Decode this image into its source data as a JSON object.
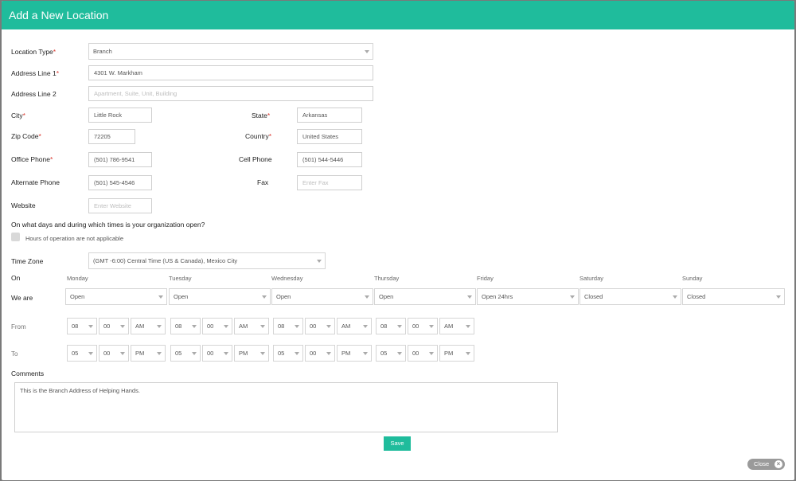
{
  "modal": {
    "title": "Add a New Location",
    "accent_color": "#1fbc9c"
  },
  "form": {
    "location_type": {
      "label": "Location Type",
      "value": "Branch"
    },
    "address1": {
      "label": "Address Line 1",
      "value": "4301 W. Markham"
    },
    "address2": {
      "label": "Address Line 2",
      "placeholder": "Apartment, Suite, Unit, Building"
    },
    "city": {
      "label": "City",
      "value": "Little Rock"
    },
    "state": {
      "label": "State",
      "value": "Arkansas"
    },
    "zip": {
      "label": "Zip Code",
      "value": "72205"
    },
    "country": {
      "label": "Country",
      "value": "United States"
    },
    "office_phone": {
      "label": "Office Phone",
      "value": "(501) 786-9541"
    },
    "cell_phone": {
      "label": "Cell Phone",
      "value": "(501) 544-5446"
    },
    "alt_phone": {
      "label": "Alternate Phone",
      "value": "(501) 545-4546"
    },
    "fax": {
      "label": "Fax",
      "placeholder": "Enter Fax"
    },
    "website": {
      "label": "Website",
      "placeholder": "Enter Website"
    },
    "required_mark": "*"
  },
  "hours": {
    "question": "On what days and during which times is your organization open?",
    "not_applicable": "Hours of operation are not applicable",
    "timezone_label": "Time Zone",
    "timezone_value": "(GMT -6:00) Central Time (US & Canada), Mexico City",
    "on_label": "On",
    "we_are_label": "We are",
    "from_label": "From",
    "to_label": "To",
    "days": [
      {
        "name": "Monday",
        "status": "Open",
        "from": [
          "08",
          "00",
          "AM"
        ],
        "to": [
          "05",
          "00",
          "PM"
        ]
      },
      {
        "name": "Tuesday",
        "status": "Open",
        "from": [
          "08",
          "00",
          "AM"
        ],
        "to": [
          "05",
          "00",
          "PM"
        ]
      },
      {
        "name": "Wednesday",
        "status": "Open",
        "from": [
          "08",
          "00",
          "AM"
        ],
        "to": [
          "05",
          "00",
          "PM"
        ]
      },
      {
        "name": "Thursday",
        "status": "Open",
        "from": [
          "08",
          "00",
          "AM"
        ],
        "to": [
          "05",
          "00",
          "PM"
        ]
      },
      {
        "name": "Friday",
        "status": "Open 24hrs"
      },
      {
        "name": "Saturday",
        "status": "Closed"
      },
      {
        "name": "Sunday",
        "status": "Closed"
      }
    ]
  },
  "comments": {
    "label": "Comments",
    "value": "This is the Branch Address of Helping Hands."
  },
  "actions": {
    "save_label": "Save",
    "close_label": "Close"
  }
}
